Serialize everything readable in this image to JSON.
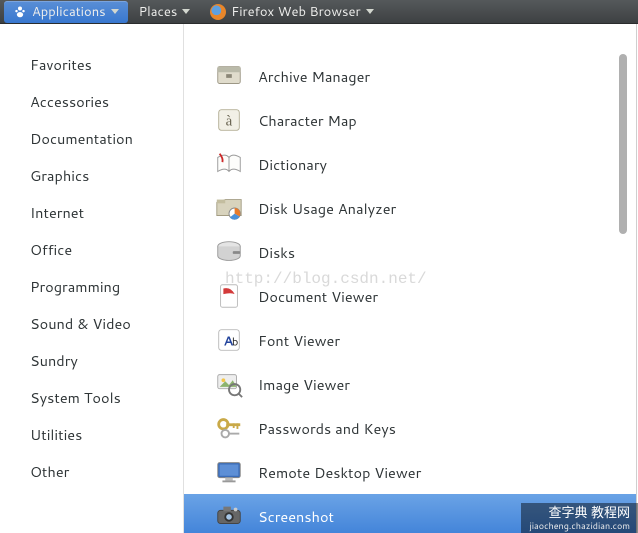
{
  "topbar": {
    "applications": "Applications",
    "places": "Places",
    "firefox": "Firefox Web Browser"
  },
  "categories": [
    "Favorites",
    "Accessories",
    "Documentation",
    "Graphics",
    "Internet",
    "Office",
    "Programming",
    "Sound & Video",
    "Sundry",
    "System Tools",
    "Utilities",
    "Other"
  ],
  "apps": [
    {
      "label": "Archive Manager",
      "icon": "archive"
    },
    {
      "label": "Character Map",
      "icon": "charmap"
    },
    {
      "label": "Dictionary",
      "icon": "dictionary"
    },
    {
      "label": "Disk Usage Analyzer",
      "icon": "diskusage"
    },
    {
      "label": "Disks",
      "icon": "disks"
    },
    {
      "label": "Document Viewer",
      "icon": "docviewer"
    },
    {
      "label": "Font Viewer",
      "icon": "fontviewer"
    },
    {
      "label": "Image Viewer",
      "icon": "imageviewer"
    },
    {
      "label": "Passwords and Keys",
      "icon": "keys"
    },
    {
      "label": "Remote Desktop Viewer",
      "icon": "remote"
    },
    {
      "label": "Screenshot",
      "icon": "screenshot"
    }
  ],
  "selected_app_index": 10,
  "watermark": "http://blog.csdn.net/",
  "badge": {
    "main": "查字典 教程网",
    "sub": "jiaocheng.chazidian.com"
  }
}
